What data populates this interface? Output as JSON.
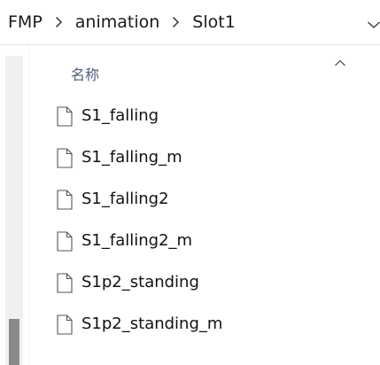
{
  "breadcrumb": {
    "items": [
      "FMP",
      "animation",
      "Slot1"
    ]
  },
  "list": {
    "column_name": "名称",
    "files": [
      "S1_falling",
      "S1_falling_m",
      "S1_falling2",
      "S1_falling2_m",
      "S1p2_standing",
      "S1p2_standing_m"
    ]
  },
  "icons": {
    "breadcrumb_separator": "chevron-right-icon",
    "address_dropdown": "chevron-down-icon",
    "sort_indicator": "chevron-up-icon",
    "file": "file-icon"
  },
  "colors": {
    "column_header": "#4c607a",
    "scrollbar_thumb": "#8a8a8a",
    "scrollbar_track": "#f0f0f0"
  }
}
